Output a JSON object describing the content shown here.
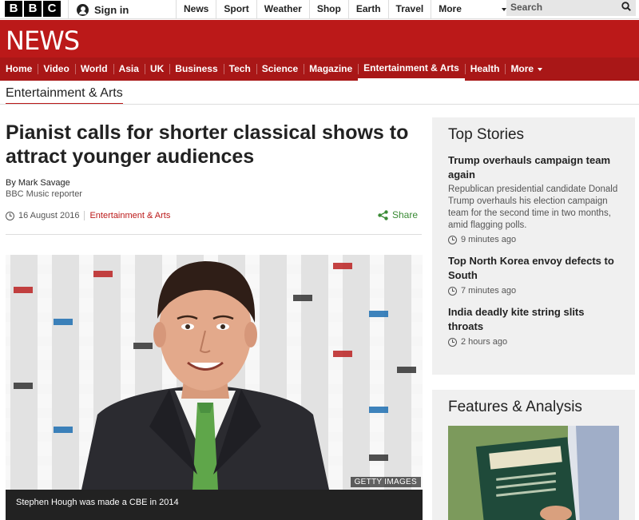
{
  "masthead": {
    "logo_letters": [
      "B",
      "B",
      "C"
    ],
    "signin_label": "Sign in",
    "nav": [
      "News",
      "Sport",
      "Weather",
      "Shop",
      "Earth",
      "Travel"
    ],
    "more_label": "More",
    "search_placeholder": "Search"
  },
  "banner": {
    "title": "NEWS"
  },
  "section_nav": {
    "items": [
      "Home",
      "Video",
      "World",
      "Asia",
      "UK",
      "Business",
      "Tech",
      "Science",
      "Magazine",
      "Entertainment & Arts",
      "Health"
    ],
    "active": "Entertainment & Arts",
    "more_label": "More"
  },
  "subsection": {
    "title": "Entertainment & Arts"
  },
  "article": {
    "headline": "Pianist calls for shorter classical shows to attract younger audiences",
    "author": "By Mark Savage",
    "author_role": "BBC Music reporter",
    "date": "16 August 2016",
    "section": "Entertainment & Arts",
    "share_label": "Share",
    "image_credit": "GETTY IMAGES",
    "caption": "Stephen Hough was made a CBE in 2014"
  },
  "top_stories": {
    "heading": "Top Stories",
    "items": [
      {
        "title": "Trump overhauls campaign team again",
        "summary": "Republican presidential candidate Donald Trump overhauls his election campaign team for the second time in two months, amid flagging polls.",
        "time": "9 minutes ago"
      },
      {
        "title": "Top North Korea envoy defects to South",
        "time": "7 minutes ago"
      },
      {
        "title": "India deadly kite string slits throats",
        "time": "2 hours ago"
      }
    ]
  },
  "features": {
    "heading": "Features & Analysis"
  },
  "colors": {
    "brand_red": "#bb1919",
    "nav_red": "#a91717",
    "share_green": "#3a8b35"
  },
  "icons": [
    "user-icon",
    "search-icon",
    "clock-icon",
    "share-icon"
  ]
}
